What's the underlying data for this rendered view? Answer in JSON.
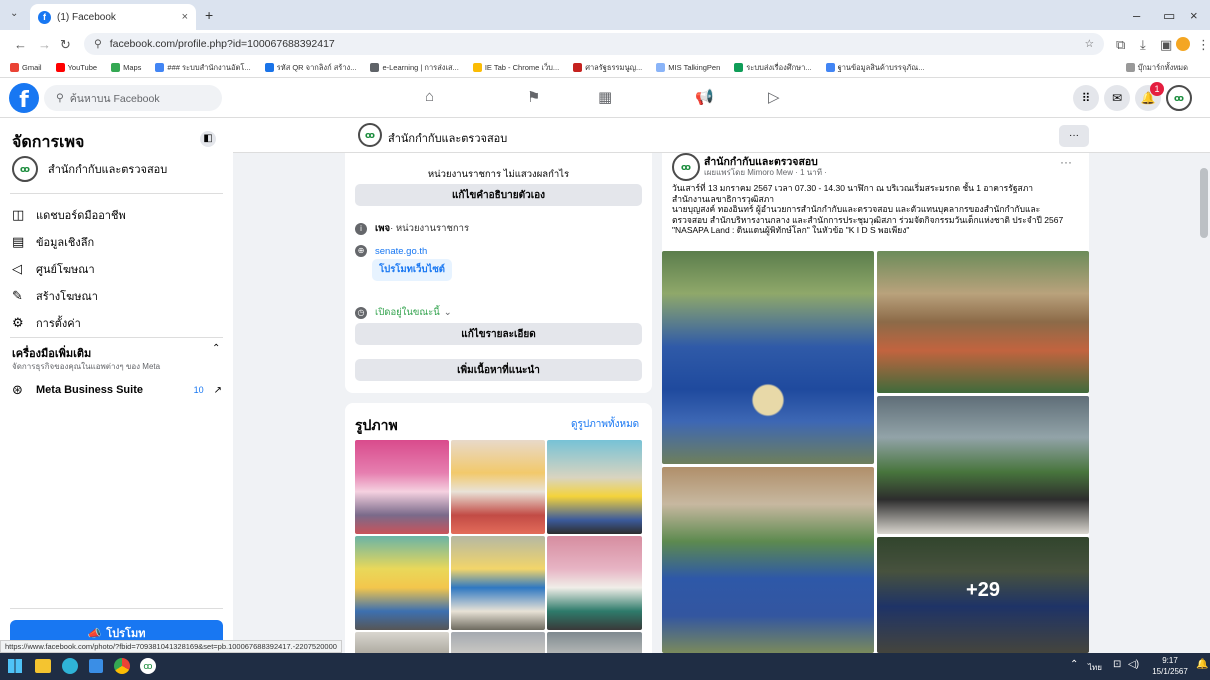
{
  "browser": {
    "tab_title": "(1) Facebook",
    "url": "facebook.com/profile.php?id=100067688392417",
    "bookmarks": [
      "Gmail",
      "YouTube",
      "Maps",
      "### ระบบสำนักงานอัตโ...",
      "รหัส QR จากลิงก์ สร้าง...",
      "e-Learning | การส่งเส...",
      "IE Tab - Chrome เว็บ...",
      "ศาลรัฐธรรมนูญ...",
      "MIS TalkingPen",
      "ระบบส่งเรื่องศึกษา...",
      "ฐานข้อมูลสินค้าบรรจุภัณ..."
    ],
    "all_bookmarks": "บุ๊กมาร์กทั้งหมด",
    "status_url": "https://www.facebook.com/photo/?fbid=709381041328169&set=pb.100067688392417.-2207520000"
  },
  "fb_header": {
    "search_placeholder": "ค้นหาบน Facebook",
    "notif_count": "1"
  },
  "sidebar": {
    "title": "จัดการเพจ",
    "page_name": "สำนักกำกับและตรวจสอบ",
    "items": [
      "แดชบอร์ดมืออาชีพ",
      "ข้อมูลเชิงลึก",
      "ศูนย์โฆษณา",
      "สร้างโฆษณา",
      "การตั้งค่า"
    ],
    "tools_title": "เครื่องมือเพิ่มเติม",
    "tools_sub": "จัดการธุรกิจของคุณในแอพต่างๆ ของ Meta",
    "mbs_label": "Meta Business Suite",
    "mbs_count": "10",
    "promote": "โปรโมท"
  },
  "pagebar": {
    "name": "สำนักกำกับและตรวจสอบ",
    "more": "···"
  },
  "intro": {
    "tagline": "หน่วยงานราชการ ไม่แสวงผลกำไร",
    "edit_bio": "แก้ไขคำอธิบายตัวเอง",
    "category_bold": "เพจ",
    "category": " · หน่วยงานราชการ",
    "website": "senate.go.th",
    "promote_site": "โปรโมทเว็บไซต์",
    "open_now": "เปิดอยู่ในขณะนี้",
    "edit_details": "แก้ไขรายละเอียด",
    "add_featured": "เพิ่มเนื้อหาที่แนะนำ"
  },
  "photos": {
    "title": "รูปภาพ",
    "see_all": "ดูรูปภาพทั้งหมด"
  },
  "post": {
    "author": "สำนักกำกับและตรวจสอบ",
    "meta": "เผยแพร่โดย Mimoro Mew · 1 นาที ·",
    "line1": "วันเสาร์ที่ 13 มกราคม 2567 เวลา 07.30 - 14.30 นาฬิกา ณ บริเวณเริ่มสระมรกต ชั้น 1 อาคารรัฐสภา",
    "line2": "สำนักงานเลขาธิการวุฒิสภา",
    "line3": "นายบุญสงค์  ทองอินทร์ ผู้อำนวยการสำนักกำกับและตรวจสอบ และตัวแทนบุคลากรของสำนักกำกับและ",
    "line4": "ตรวจสอบ สำนักบริหารงานกลาง และสำนักการประชุมวุฒิสภา ร่วมจัดกิจกรรมวันเด็กแห่งชาติ ประจำปี 2567",
    "line5": "\"NASAPA Land : ดินแดนผู้พิทักษ์โลก\" ในหัวข้อ \"K I D S พอเพียง\"",
    "more_count": "+29"
  },
  "taskbar": {
    "time": "9:17",
    "date": "15/1/2567",
    "lang": "ไทย"
  },
  "colors": {
    "fb_blue": "#1877f2",
    "page_bg": "#f0f2f5",
    "taskbar": "#1f2d44"
  }
}
